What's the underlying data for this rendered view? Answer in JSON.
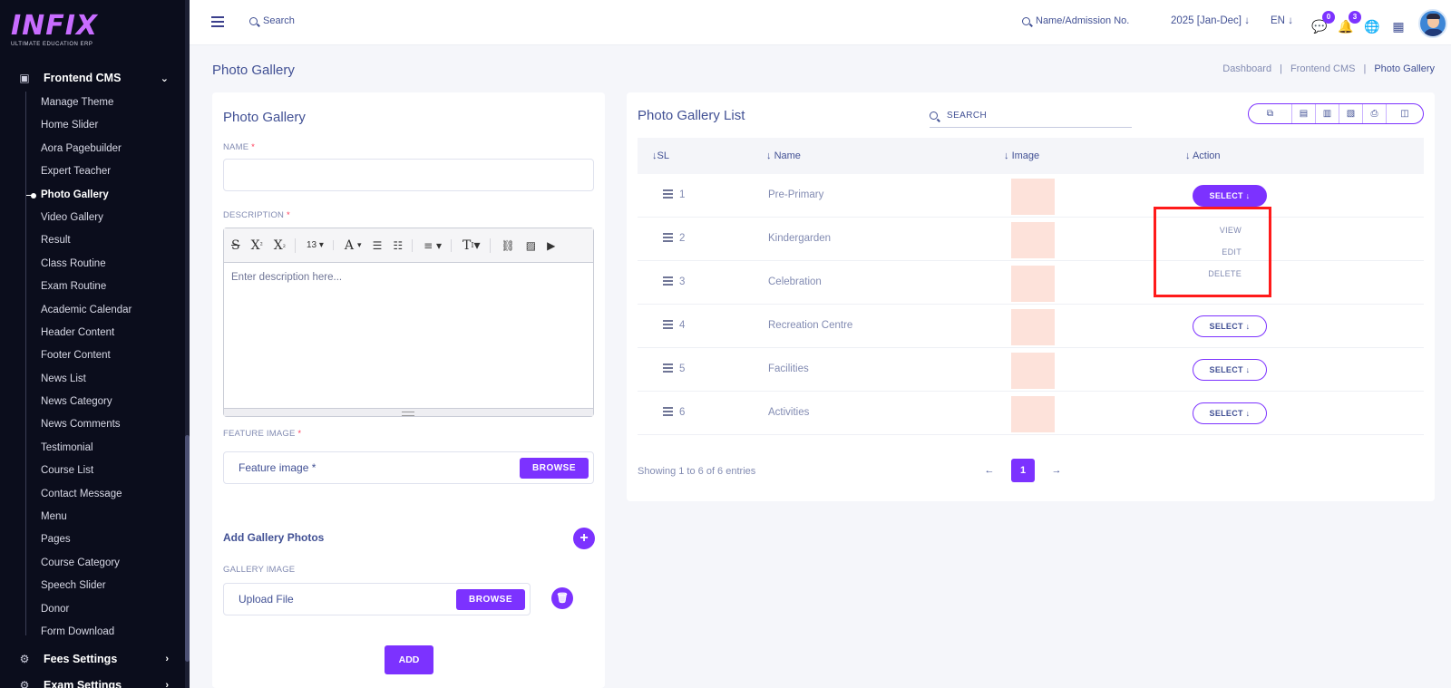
{
  "brand": {
    "logo": "INFIX",
    "tagline": "ULTIMATE EDUCATION ERP"
  },
  "sidebar": {
    "group": "Frontend CMS",
    "items": [
      "Manage Theme",
      "Home Slider",
      "Aora Pagebuilder",
      "Expert Teacher",
      "Photo Gallery",
      "Video Gallery",
      "Result",
      "Class Routine",
      "Exam Routine",
      "Academic Calendar",
      "Header Content",
      "Footer Content",
      "News List",
      "News Category",
      "News Comments",
      "Testimonial",
      "Course List",
      "Contact Message",
      "Menu",
      "Pages",
      "Course Category",
      "Speech Slider",
      "Donor",
      "Form Download"
    ],
    "active_item": "Photo Gallery",
    "lower": [
      "Fees Settings",
      "Exam Settings"
    ]
  },
  "topbar": {
    "search_placeholder": "Search",
    "admission_placeholder": "Name/Admission No.",
    "year": "2025 [Jan-Dec]",
    "lang": "EN",
    "msg_badge": "0",
    "notif_badge": "3"
  },
  "page": {
    "title": "Photo Gallery",
    "breadcrumb": [
      "Dashboard",
      "Frontend CMS",
      "Photo Gallery"
    ]
  },
  "form": {
    "title": "Photo Gallery",
    "name_label": "NAME",
    "description_label": "DESCRIPTION",
    "editor_font_size": "13",
    "description_placeholder": "Enter description here...",
    "feature_label": "FEATURE IMAGE",
    "feature_placeholder": "Feature image *",
    "browse": "BROWSE",
    "add_photos_title": "Add Gallery Photos",
    "gallery_label": "GALLERY IMAGE",
    "upload_placeholder": "Upload File",
    "add_button": "ADD",
    "required_mark": "*"
  },
  "list": {
    "title": "Photo Gallery List",
    "search_placeholder": "SEARCH",
    "columns": [
      "SL",
      "Name",
      "Image",
      "Action"
    ],
    "rows": [
      {
        "sl": "1",
        "name": "Pre-Primary"
      },
      {
        "sl": "2",
        "name": "Kindergarden"
      },
      {
        "sl": "3",
        "name": "Celebration"
      },
      {
        "sl": "4",
        "name": "Recreation Centre"
      },
      {
        "sl": "5",
        "name": "Facilities"
      },
      {
        "sl": "6",
        "name": "Activities"
      }
    ],
    "select_label": "SELECT",
    "dropdown": [
      "VIEW",
      "EDIT",
      "DELETE"
    ],
    "info": "Showing 1 to 6 of 6 entries",
    "current_page": "1"
  },
  "colors": {
    "accent": "#7c32ff",
    "sidebar_bg": "#0b0d1c",
    "highlight": "#ff1a1a"
  }
}
